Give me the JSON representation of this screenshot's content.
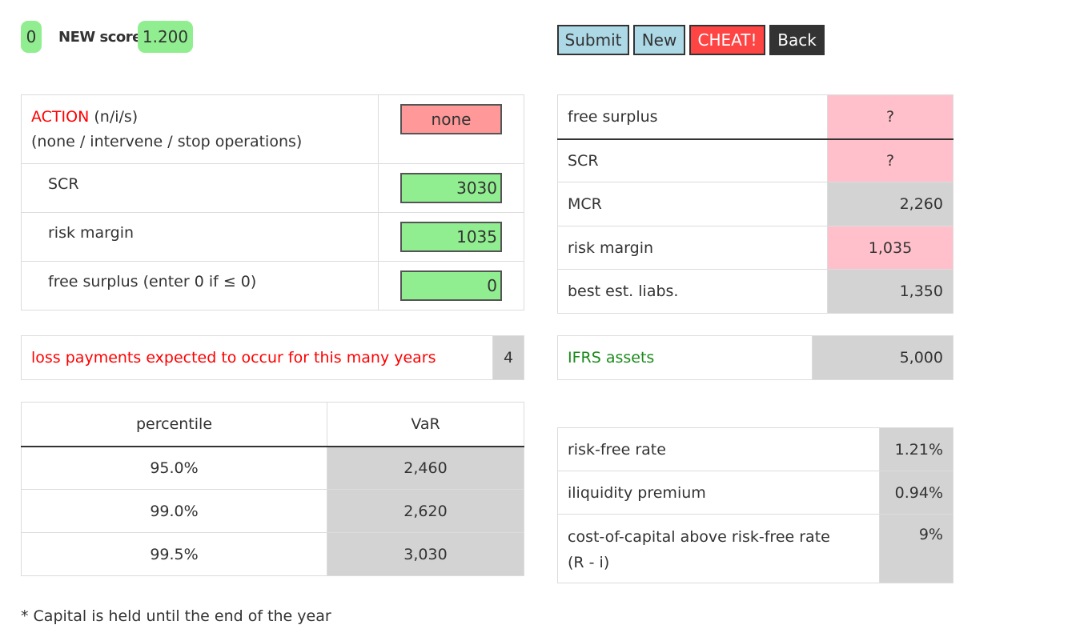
{
  "score": {
    "count": "0",
    "label": "NEW score",
    "value": "1.200"
  },
  "buttons": {
    "submit": "Submit",
    "new": "New",
    "cheat": "CHEAT!",
    "back": "Back"
  },
  "colors": {
    "green_pill": "#90ee90",
    "submit_bg": "#add8e6",
    "cheat_bg": "#ff4444",
    "back_bg": "#333333",
    "input_green": "#90ee90",
    "input_red": "#ff9999",
    "pink": "#ffc0cb",
    "grey": "#d3d3d3"
  },
  "input_table": {
    "action_title": "ACTION",
    "action_hint": "(n/i/s)",
    "action_sub": "(none / intervene / stop operations)",
    "action_value": "none",
    "rows": [
      {
        "label": "SCR",
        "value": "3030"
      },
      {
        "label": "risk margin",
        "value": "1035"
      },
      {
        "label": "free surplus (enter 0 if ≤ 0)",
        "value": "0"
      }
    ]
  },
  "loss_years": {
    "label": "loss payments expected to occur for this many years",
    "value": "4"
  },
  "var_table": {
    "headers": [
      "percentile",
      "VaR"
    ],
    "rows": [
      {
        "percentile": "95.0%",
        "var": "2,460"
      },
      {
        "percentile": "99.0%",
        "var": "2,620"
      },
      {
        "percentile": "99.5%",
        "var": "3,030"
      }
    ]
  },
  "balance_table": {
    "rows": [
      {
        "label": "free surplus",
        "value": "?"
      },
      {
        "label": "SCR",
        "value": "?"
      },
      {
        "label": "MCR",
        "value": "2,260"
      },
      {
        "label": "risk margin",
        "value": "1,035"
      },
      {
        "label": "best est. liabs.",
        "value": "1,350"
      }
    ]
  },
  "ifrs": {
    "label": "IFRS assets",
    "value": "5,000"
  },
  "rates_table": {
    "rows": [
      {
        "label": "risk-free rate",
        "value": "1.21%"
      },
      {
        "label": "iliquidity premium",
        "value": "0.94%"
      },
      {
        "label": "cost-of-capital above risk-free rate",
        "label2": "(R - i)",
        "value": "9%"
      }
    ]
  },
  "footnote": "* Capital is held until the end of the year"
}
